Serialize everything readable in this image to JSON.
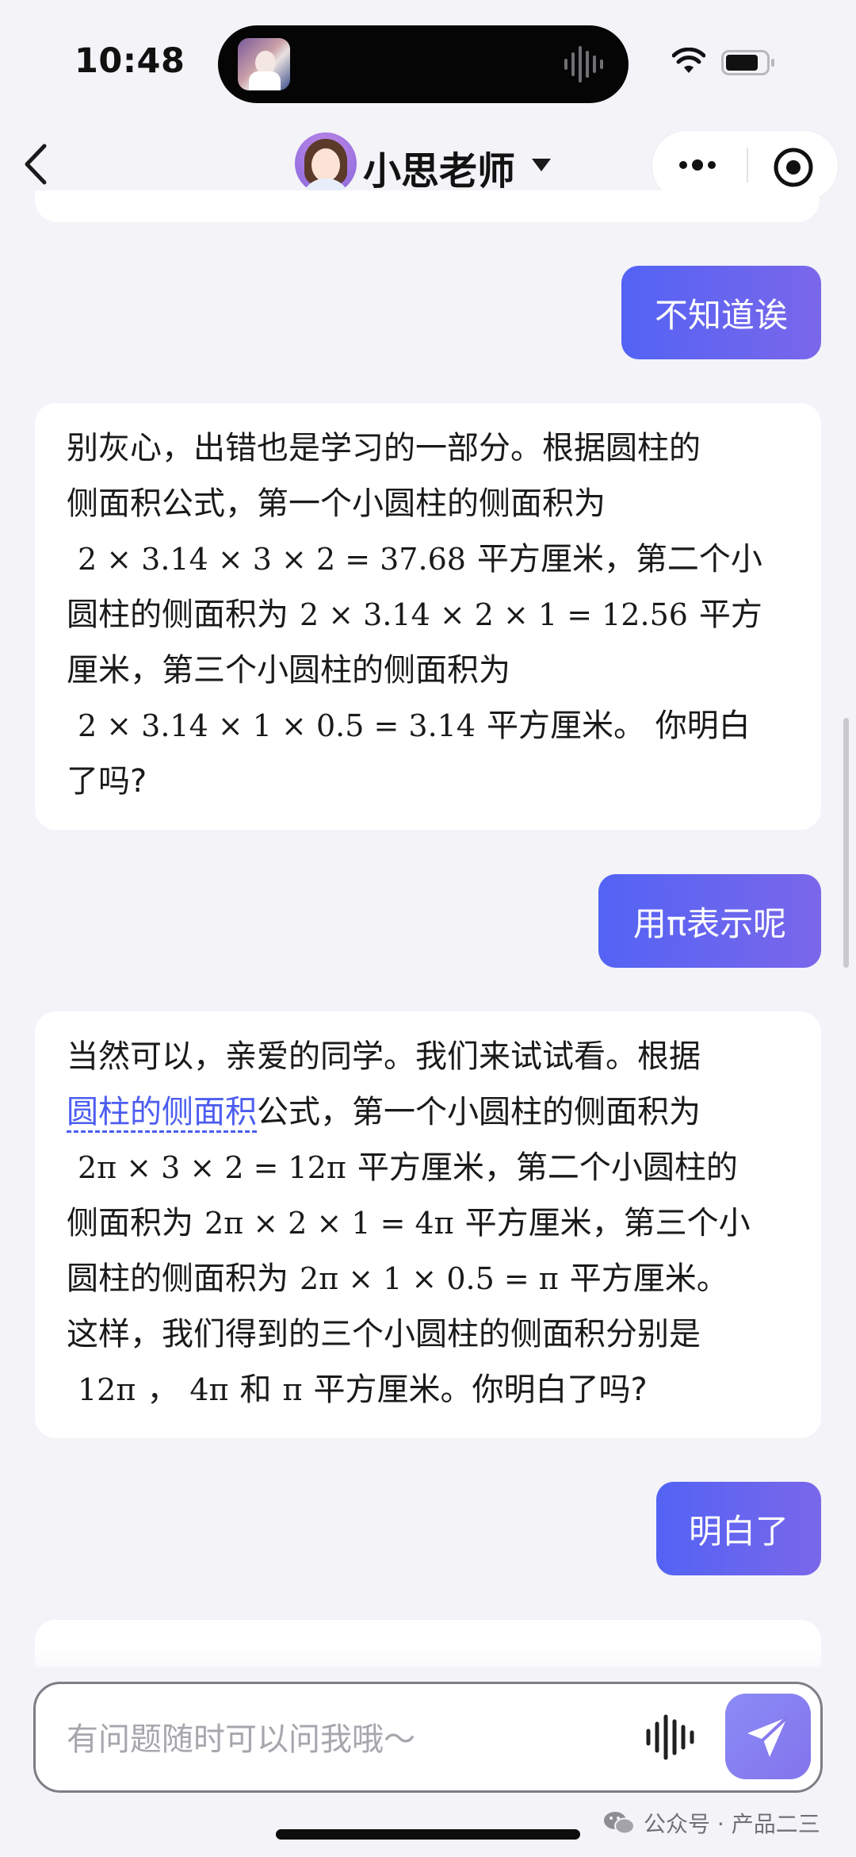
{
  "status": {
    "time": "10:48"
  },
  "header": {
    "title": "小思老师"
  },
  "messages": [
    {
      "role": "user",
      "text": "不知道诶"
    },
    {
      "role": "assistant",
      "lines": [
        [
          "别灰心，出错也是学习的一部分。根据圆柱的"
        ],
        [
          "侧面积公式，第一个小圆柱的侧面积为"
        ],
        [
          "2 × 3.14 × 3 × 2 = 37.68",
          "平方厘米，第二个小"
        ],
        [
          "圆柱的侧面积为",
          "2 × 3.14 × 2 × 1 = 12.56",
          "平方"
        ],
        [
          "厘米，第三个小圆柱的侧面积为"
        ],
        [
          "2 × 3.14 × 1 × 0.5 = 3.14",
          "平方厘米。 你明白"
        ],
        [
          "了吗?"
        ]
      ]
    },
    {
      "role": "user",
      "text": "用π表示呢"
    },
    {
      "role": "assistant",
      "link": "圆柱的侧面积",
      "lines": [
        [
          "当然可以，亲爱的同学。我们来试试看。根据"
        ],
        [
          "公式，第一个小圆柱的侧面积为"
        ],
        [
          "2π × 3 × 2 = 12π",
          "平方厘米，第二个小圆柱的"
        ],
        [
          "侧面积为",
          "2π × 2 × 1 = 4π",
          "平方厘米，第三个小"
        ],
        [
          "圆柱的侧面积为",
          "2π × 1 × 0.5 = π",
          "平方厘米。"
        ],
        [
          "这样，我们得到的三个小圆柱的侧面积分别是"
        ],
        [
          "12π",
          "，",
          "4π",
          "和",
          "π",
          "平方厘米。你明白了吗?"
        ]
      ]
    },
    {
      "role": "user",
      "text": "明白了"
    }
  ],
  "input": {
    "placeholder": "有问题随时可以问我哦～"
  },
  "watermark": "公众号 · 产品二三",
  "icons": [
    "back-icon",
    "caret-down-icon",
    "more-icon",
    "target-icon",
    "wifi-icon",
    "battery-icon",
    "voice-icon",
    "send-icon",
    "wechat-icon"
  ],
  "colors": {
    "user_bubble_start": "#5363f4",
    "user_bubble_end": "#7a67ea",
    "link": "#4c5df0",
    "send_button": "#8b8cf6",
    "background": "#f3f3f8"
  }
}
